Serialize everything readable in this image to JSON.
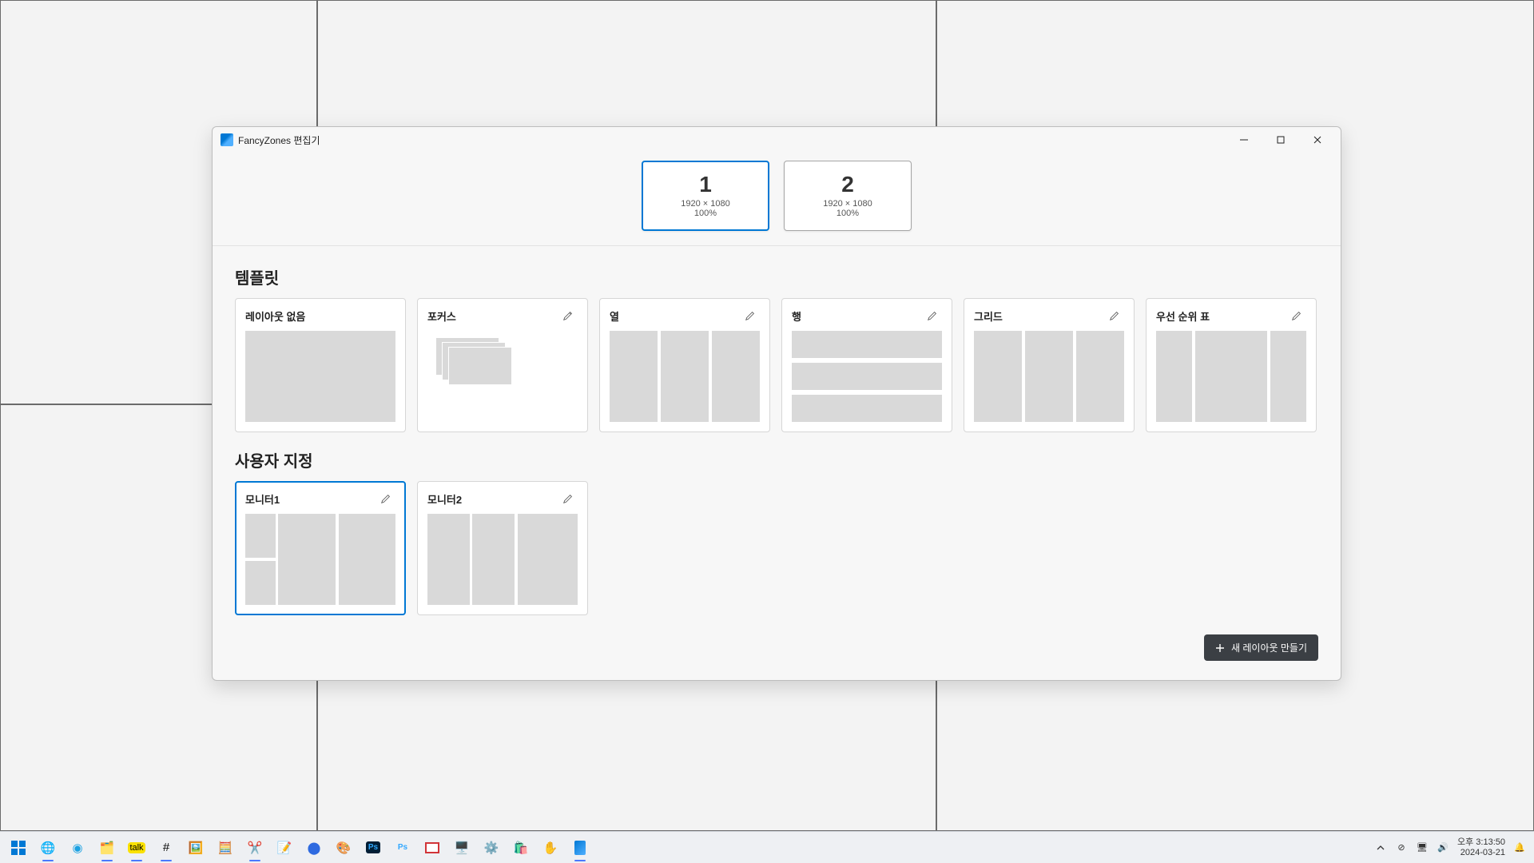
{
  "window": {
    "title": "FancyZones 편집기"
  },
  "monitors": [
    {
      "num": "1",
      "res": "1920 × 1080",
      "scale": "100%",
      "selected": true
    },
    {
      "num": "2",
      "res": "1920 × 1080",
      "scale": "100%",
      "selected": false
    }
  ],
  "sections": {
    "templates": "템플릿",
    "custom": "사용자 지정"
  },
  "templates": [
    {
      "key": "none",
      "label": "레이아웃 없음",
      "editable": false
    },
    {
      "key": "focus",
      "label": "포커스",
      "editable": true
    },
    {
      "key": "columns",
      "label": "열",
      "editable": true
    },
    {
      "key": "rows",
      "label": "행",
      "editable": true
    },
    {
      "key": "grid",
      "label": "그리드",
      "editable": true
    },
    {
      "key": "priority",
      "label": "우선 순위 표",
      "editable": true
    }
  ],
  "custom": [
    {
      "key": "mon1",
      "label": "모니터1",
      "selected": true
    },
    {
      "key": "mon2",
      "label": "모니터2",
      "selected": false
    }
  ],
  "buttons": {
    "new_layout": "새 레이아웃 만들기"
  },
  "systray": {
    "time": "오후 3:13:50",
    "date": "2024-03-21"
  }
}
